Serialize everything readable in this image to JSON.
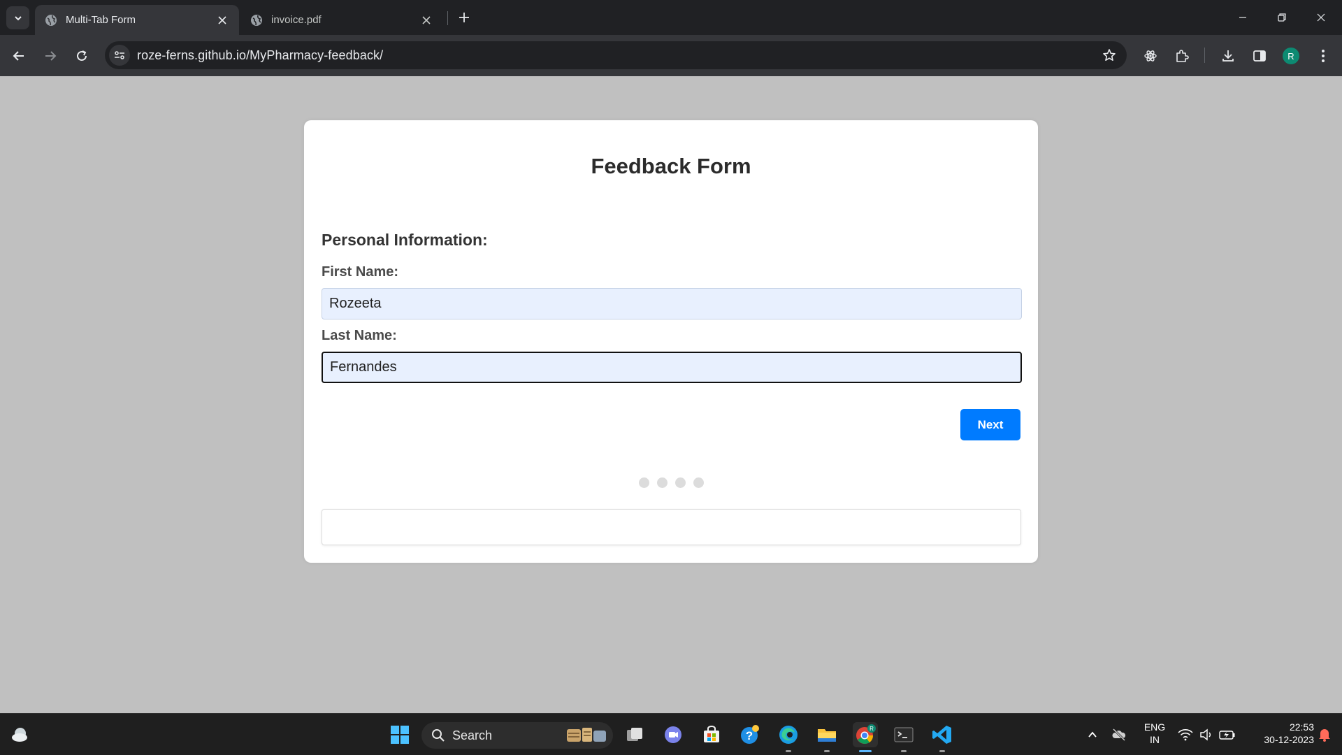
{
  "browser": {
    "tabs": [
      {
        "title": "Multi-Tab Form",
        "active": true
      },
      {
        "title": "invoice.pdf",
        "active": false
      }
    ],
    "url": "roze-ferns.github.io/MyPharmacy-feedback/",
    "profile_initial": "R"
  },
  "form": {
    "title": "Feedback Form",
    "section_title": "Personal Information:",
    "first_name_label": "First Name:",
    "first_name_value": "Rozeeta",
    "last_name_label": "Last Name:",
    "last_name_value": "Fernandes",
    "next_label": "Next",
    "step_count": 4
  },
  "taskbar": {
    "search_placeholder": "Search",
    "language_line1": "ENG",
    "language_line2": "IN",
    "time": "22:53",
    "date": "30-12-2023",
    "colors": {
      "accent": "#007bff",
      "chrome_dark": "#202124",
      "taskbar": "#1f1f1f"
    }
  }
}
